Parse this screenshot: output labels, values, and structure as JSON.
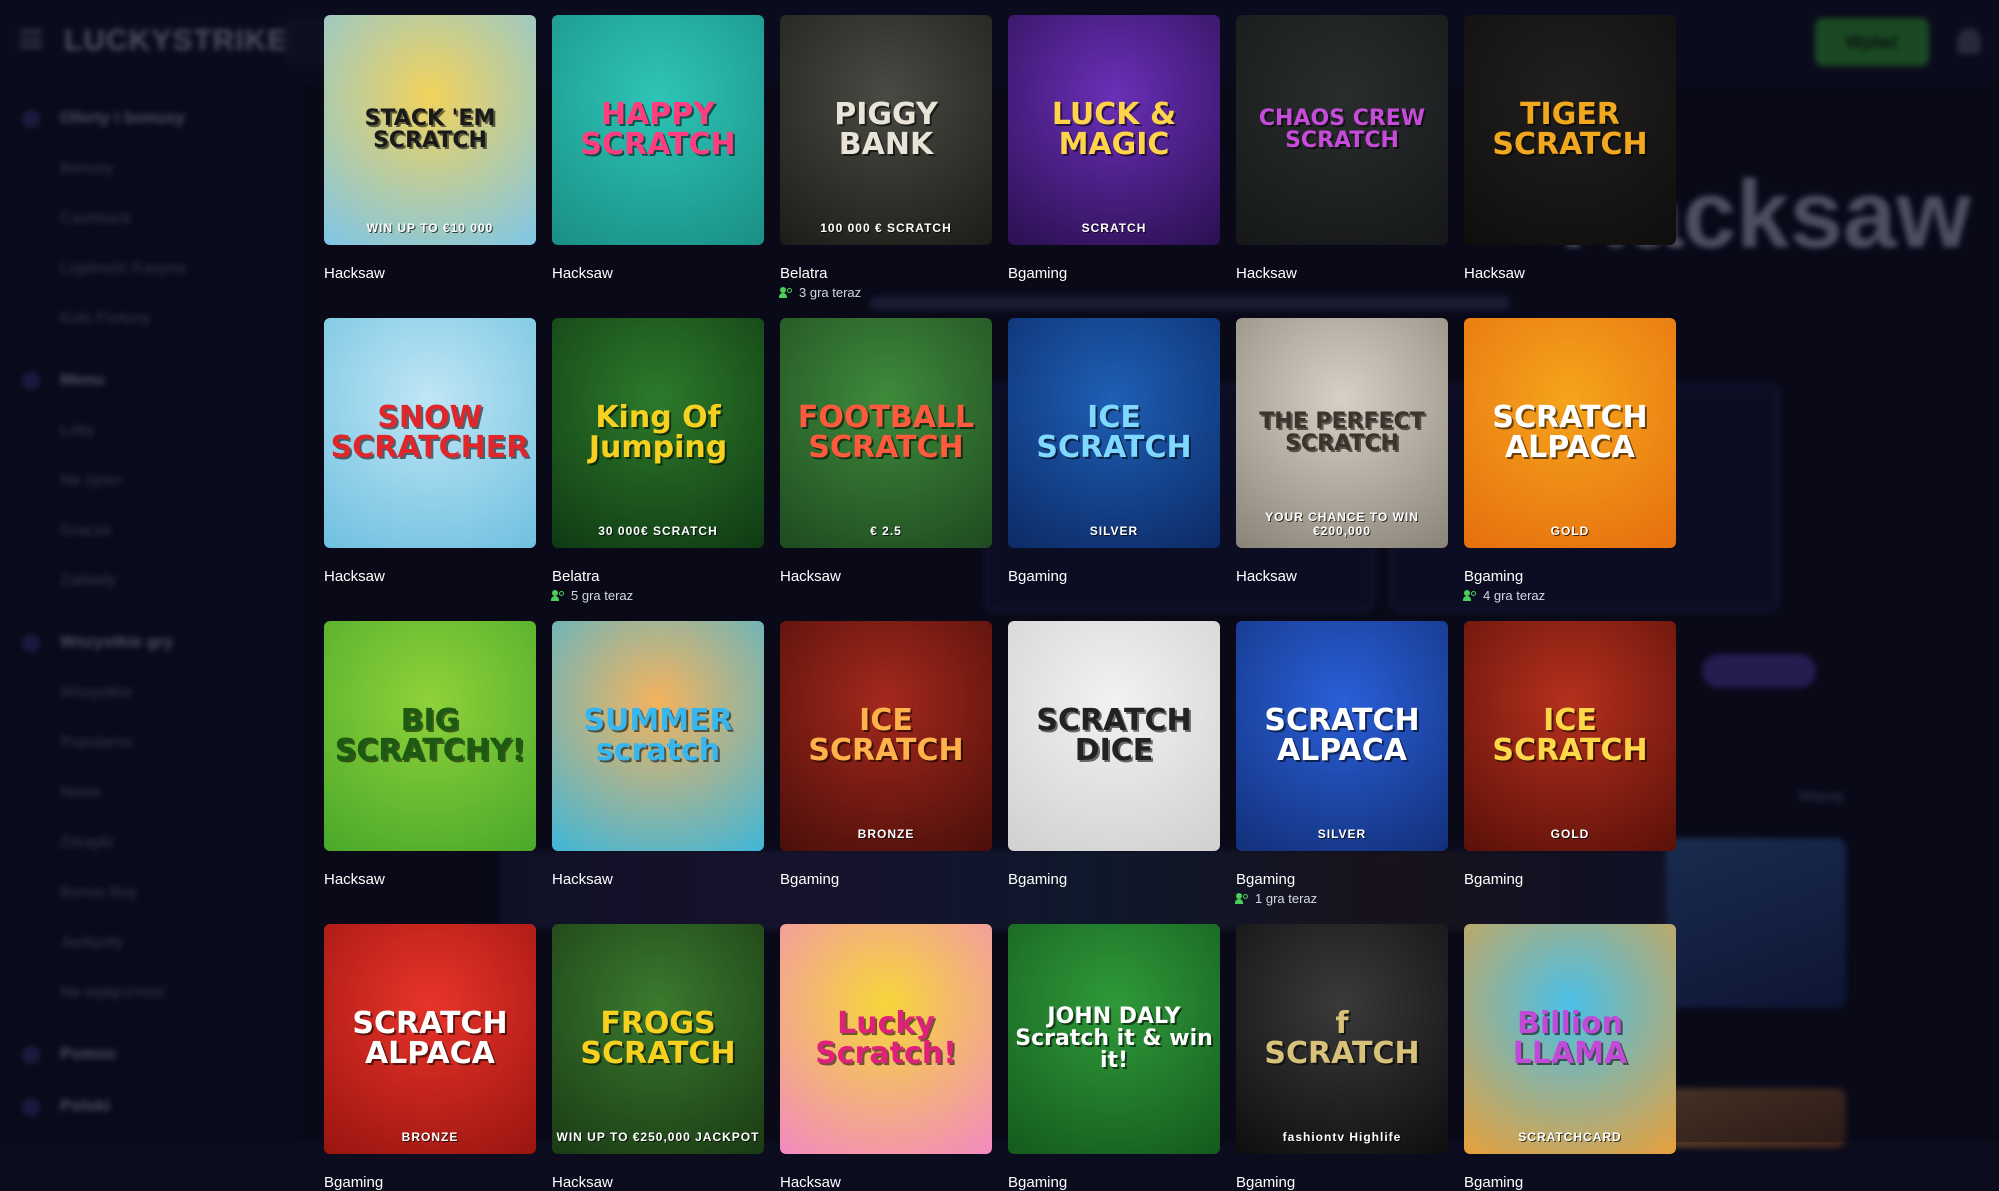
{
  "background": {
    "logo": "LUCKYSTRIKE",
    "deposit_label": "Wpłać",
    "sidebar": {
      "groups": [
        {
          "title": "Oferty i bonusy",
          "items": [
            "Bonusy",
            "Cashback",
            "Lojalność Kasyna",
            "Koło Fortuny"
          ]
        },
        {
          "title": "Menu",
          "items": [
            "Loby",
            "Na żywo",
            "Gracze",
            "Zakłady"
          ]
        },
        {
          "title": "Wszystkie gry",
          "items": [
            "Wszystkie",
            "Popularne",
            "Nowe",
            "Zdrapki",
            "Bonus Buy",
            "Jackpoty",
            "Na wyłączność"
          ]
        },
        {
          "title": "Pomoc",
          "items": []
        },
        {
          "title": "Polski",
          "items": []
        }
      ]
    },
    "hero_word": "Hacksaw",
    "more_label": "Więcej"
  },
  "games": [
    {
      "title": "STACK 'EM\nSCRATCH",
      "subtitle": "WIN UP TO €10 000",
      "provider": "Hacksaw",
      "players": "",
      "bg": "#f2d25c",
      "bg2": "#7ec6e8",
      "fg": "#1a1a1a"
    },
    {
      "title": "HAPPY\nSCRATCH",
      "subtitle": "",
      "provider": "Hacksaw",
      "players": "",
      "bg": "#2ec4b6",
      "bg2": "#1a8f85",
      "fg": "#ff3d7f"
    },
    {
      "title": "PIGGY\nBANK",
      "subtitle": "100 000 € SCRATCH",
      "provider": "Belatra",
      "players": "3 gra teraz",
      "bg": "#4a4a44",
      "bg2": "#1c1c18",
      "fg": "#e9e4d8"
    },
    {
      "title": "LUCK &\nMAGIC",
      "subtitle": "SCRATCH",
      "provider": "Bgaming",
      "players": "",
      "bg": "#6a2fb8",
      "bg2": "#2a1050",
      "fg": "#ffd44a"
    },
    {
      "title": "CHAOS CREW\nSCRATCH",
      "subtitle": "",
      "provider": "Hacksaw",
      "players": "",
      "bg": "#2a2d2e",
      "bg2": "#151718",
      "fg": "#c64bd8"
    },
    {
      "title": "TIGER\nSCRATCH",
      "subtitle": "",
      "provider": "Hacksaw",
      "players": "",
      "bg": "#22201e",
      "bg2": "#0f0e0d",
      "fg": "#f2a81e"
    },
    {
      "title": "SNOW\nSCRATCHER",
      "subtitle": "",
      "provider": "Hacksaw",
      "players": "",
      "bg": "#bfe6f5",
      "bg2": "#6fc0e0",
      "fg": "#e0262a"
    },
    {
      "title": "King Of\nJumping",
      "subtitle": "30 000€ SCRATCH",
      "provider": "Belatra",
      "players": "5 gra teraz",
      "bg": "#2d7a2a",
      "bg2": "#0f3a14",
      "fg": "#f6d11f"
    },
    {
      "title": "FOOTBALL\nSCRATCH",
      "subtitle": "€ 2.5",
      "provider": "Hacksaw",
      "players": "",
      "bg": "#3f8a3b",
      "bg2": "#1e4a20",
      "fg": "#ff5a3c"
    },
    {
      "title": "ICE\nSCRATCH",
      "subtitle": "SILVER",
      "provider": "Bgaming",
      "players": "",
      "bg": "#1e5fb5",
      "bg2": "#0c2a66",
      "fg": "#7fd8ff"
    },
    {
      "title": "THE PERFECT\nSCRATCH",
      "subtitle": "YOUR CHANCE TO WIN €200,000",
      "provider": "Hacksaw",
      "players": "",
      "bg": "#d8d0c4",
      "bg2": "#8a8478",
      "fg": "#3a342c"
    },
    {
      "title": "SCRATCH\nALPACA",
      "subtitle": "GOLD",
      "provider": "Bgaming",
      "players": "4 gra teraz",
      "bg": "#f6a41c",
      "bg2": "#e56f0e",
      "fg": "#ffffff"
    },
    {
      "title": "BIG\nSCRATCHY!",
      "subtitle": "",
      "provider": "Hacksaw",
      "players": "",
      "bg": "#8fd23a",
      "bg2": "#4aa82a",
      "fg": "#1c5a14"
    },
    {
      "title": "SUMMER\nscratch",
      "subtitle": "",
      "provider": "Hacksaw",
      "players": "",
      "bg": "#f4b35e",
      "bg2": "#3fb6d8",
      "fg": "#36b7ef"
    },
    {
      "title": "ICE\nSCRATCH",
      "subtitle": "BRONZE",
      "provider": "Bgaming",
      "players": "",
      "bg": "#a4281c",
      "bg2": "#4a0f0a",
      "fg": "#ffb24a"
    },
    {
      "title": "SCRATCH\nDICE",
      "subtitle": "",
      "provider": "Bgaming",
      "players": "",
      "bg": "#f2f2f2",
      "bg2": "#d0d0d0",
      "fg": "#222222"
    },
    {
      "title": "SCRATCH\nALPACA",
      "subtitle": "SILVER",
      "provider": "Bgaming",
      "players": "1 gra teraz",
      "bg": "#2a5fd8",
      "bg2": "#12307a",
      "fg": "#ffffff"
    },
    {
      "title": "ICE\nSCRATCH",
      "subtitle": "GOLD",
      "provider": "Bgaming",
      "players": "",
      "bg": "#b5301e",
      "bg2": "#5a1008",
      "fg": "#ffd84a"
    },
    {
      "title": "SCRATCH\nALPACA",
      "subtitle": "BRONZE",
      "provider": "Bgaming",
      "players": "",
      "bg": "#e8342a",
      "bg2": "#9a1410",
      "fg": "#ffffff"
    },
    {
      "title": "FROGS\nSCRATCH",
      "subtitle": "WIN UP TO €250,000 JACKPOT",
      "provider": "Hacksaw",
      "players": "",
      "bg": "#3a7a2e",
      "bg2": "#1a3a14",
      "fg": "#f6d11f"
    },
    {
      "title": "Lucky\nScratch!",
      "subtitle": "",
      "provider": "Hacksaw",
      "players": "",
      "bg": "#f6d63a",
      "bg2": "#f28ac0",
      "fg": "#e0207a"
    },
    {
      "title": "JOHN DALY\nScratch it & win it!",
      "subtitle": "",
      "provider": "Bgaming",
      "players": "",
      "bg": "#2f9a3a",
      "bg2": "#145a1c",
      "fg": "#ffffff"
    },
    {
      "title": "f\nSCRATCH",
      "subtitle": "fashiontv Highlife",
      "provider": "Bgaming",
      "players": "",
      "bg": "#3a3a3a",
      "bg2": "#0e0e0e",
      "fg": "#d8c27a"
    },
    {
      "title": "Billion\nLLAMA",
      "subtitle": "SCRATCHCARD",
      "provider": "Bgaming",
      "players": "",
      "bg": "#4ac0e8",
      "bg2": "#e8a03a",
      "fg": "#c24ad8"
    }
  ]
}
